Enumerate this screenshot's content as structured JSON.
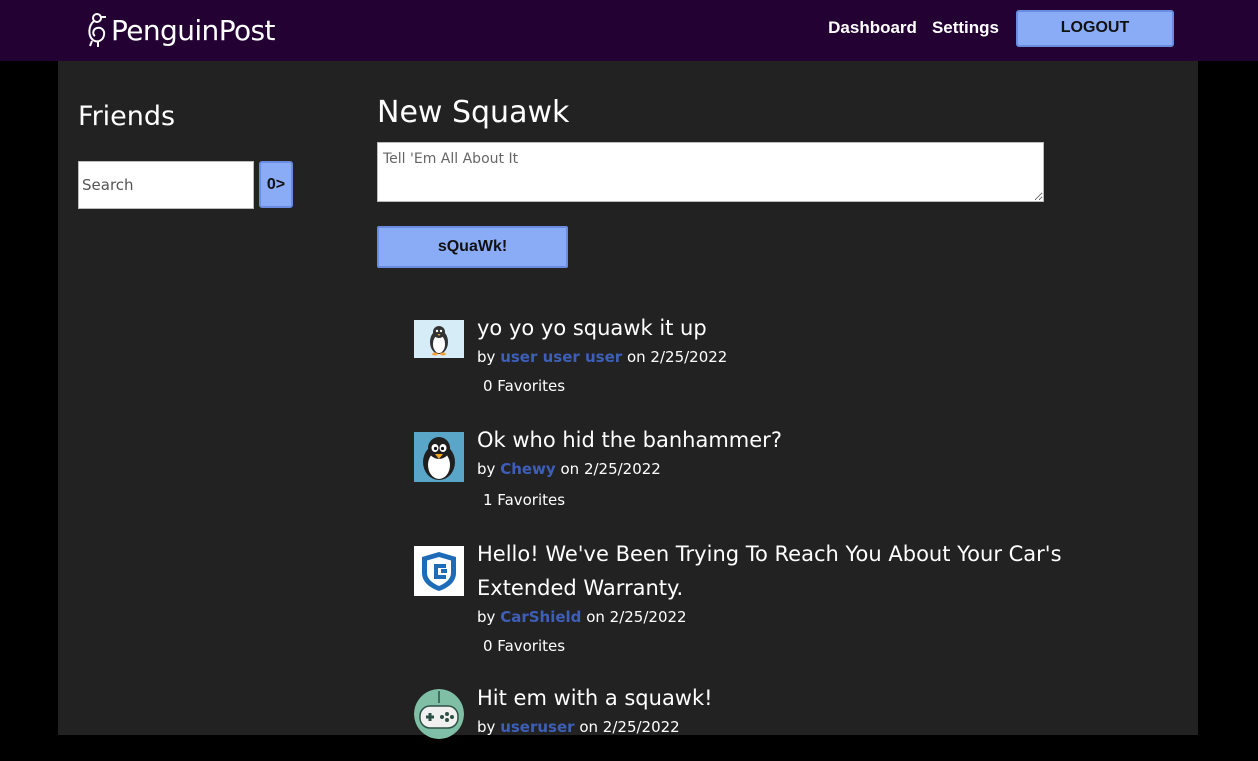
{
  "header": {
    "logo_text": "PenguinPost",
    "logo_icon": "penguin-logo-icon",
    "nav": {
      "dashboard_label": "Dashboard",
      "settings_label": "Settings",
      "logout_label": "LOGOUT"
    }
  },
  "friends": {
    "title": "Friends",
    "search_placeholder": "Search",
    "search_button_label": "0>"
  },
  "new_squawk": {
    "title": "New Squawk",
    "placeholder": "Tell 'Em All About It",
    "submit_label": "sQuaWk!"
  },
  "feed": {
    "by_label": "by",
    "on_label": "on",
    "posts": [
      {
        "text": "yo yo yo squawk it up",
        "author": "user user user",
        "date": "2/25/2022",
        "favorites": "0 Favorites",
        "avatar_icon": "penguin-avatar-icon"
      },
      {
        "text": "Ok who hid the banhammer?",
        "author": "Chewy",
        "date": "2/25/2022",
        "favorites": "1 Favorites",
        "avatar_icon": "penguin-avatar-icon"
      },
      {
        "text": "Hello! We've Been Trying To Reach You About Your Car's Extended Warranty.",
        "author": "CarShield",
        "date": "2/25/2022",
        "favorites": "0 Favorites",
        "avatar_icon": "shield-logo-icon"
      },
      {
        "text": "Hit em with a squawk!",
        "author": "useruser",
        "date": "2/25/2022",
        "favorites": "",
        "avatar_icon": "gamepad-icon"
      }
    ]
  },
  "colors": {
    "header_bg": "#230133",
    "panel_bg": "#222222",
    "page_bg": "#000000",
    "button_bg": "#8aacf7",
    "author_link": "#3d5fb8"
  }
}
